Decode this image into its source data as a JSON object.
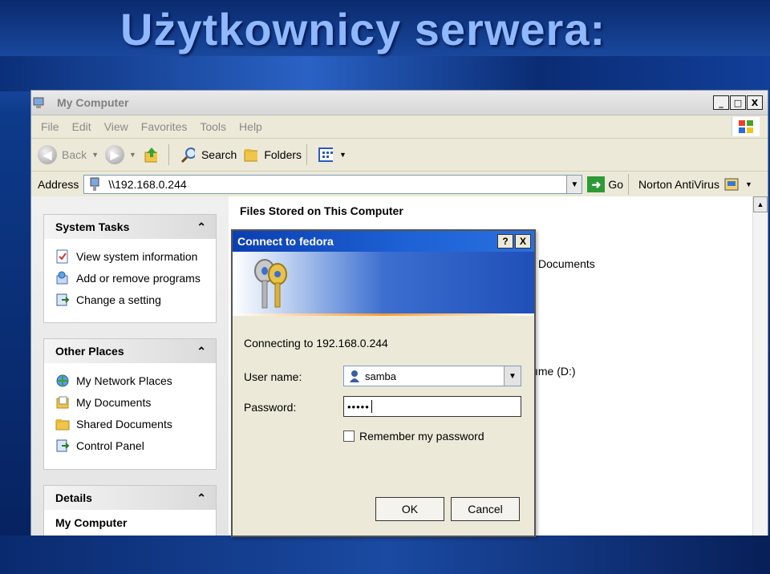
{
  "slide": {
    "title": "Użytkownicy serwera:"
  },
  "window": {
    "title": "My Computer",
    "controls": {
      "minimize": "_",
      "maximize": "□",
      "close": "X"
    },
    "menu": [
      "File",
      "Edit",
      "View",
      "Favorites",
      "Tools",
      "Help"
    ],
    "toolbar": {
      "back": "Back",
      "search": "Search",
      "folders": "Folders"
    },
    "address": {
      "label": "Address",
      "value": "\\\\192.168.0.244",
      "go": "Go",
      "norton": "Norton AntiVirus"
    }
  },
  "left_pane": {
    "system_tasks": {
      "title": "System Tasks",
      "items": [
        "View system information",
        "Add or remove programs",
        "Change a setting"
      ]
    },
    "other_places": {
      "title": "Other Places",
      "items": [
        "My Network Places",
        "My Documents",
        "Shared Documents",
        "Control Panel"
      ]
    },
    "details": {
      "title": "Details",
      "subtitle": "My Computer"
    }
  },
  "main": {
    "files_heading": "Files Stored on This Computer",
    "partial_documents": "Documents",
    "partial_volume": "ıme (D:)"
  },
  "dialog": {
    "title": "Connect to fedora",
    "help": "?",
    "close": "X",
    "connecting": "Connecting to 192.168.0.244",
    "user_label": "User name:",
    "user_value": "samba",
    "password_label": "Password:",
    "password_value": "•••••",
    "remember": "Remember my password",
    "ok": "OK",
    "cancel": "Cancel"
  }
}
